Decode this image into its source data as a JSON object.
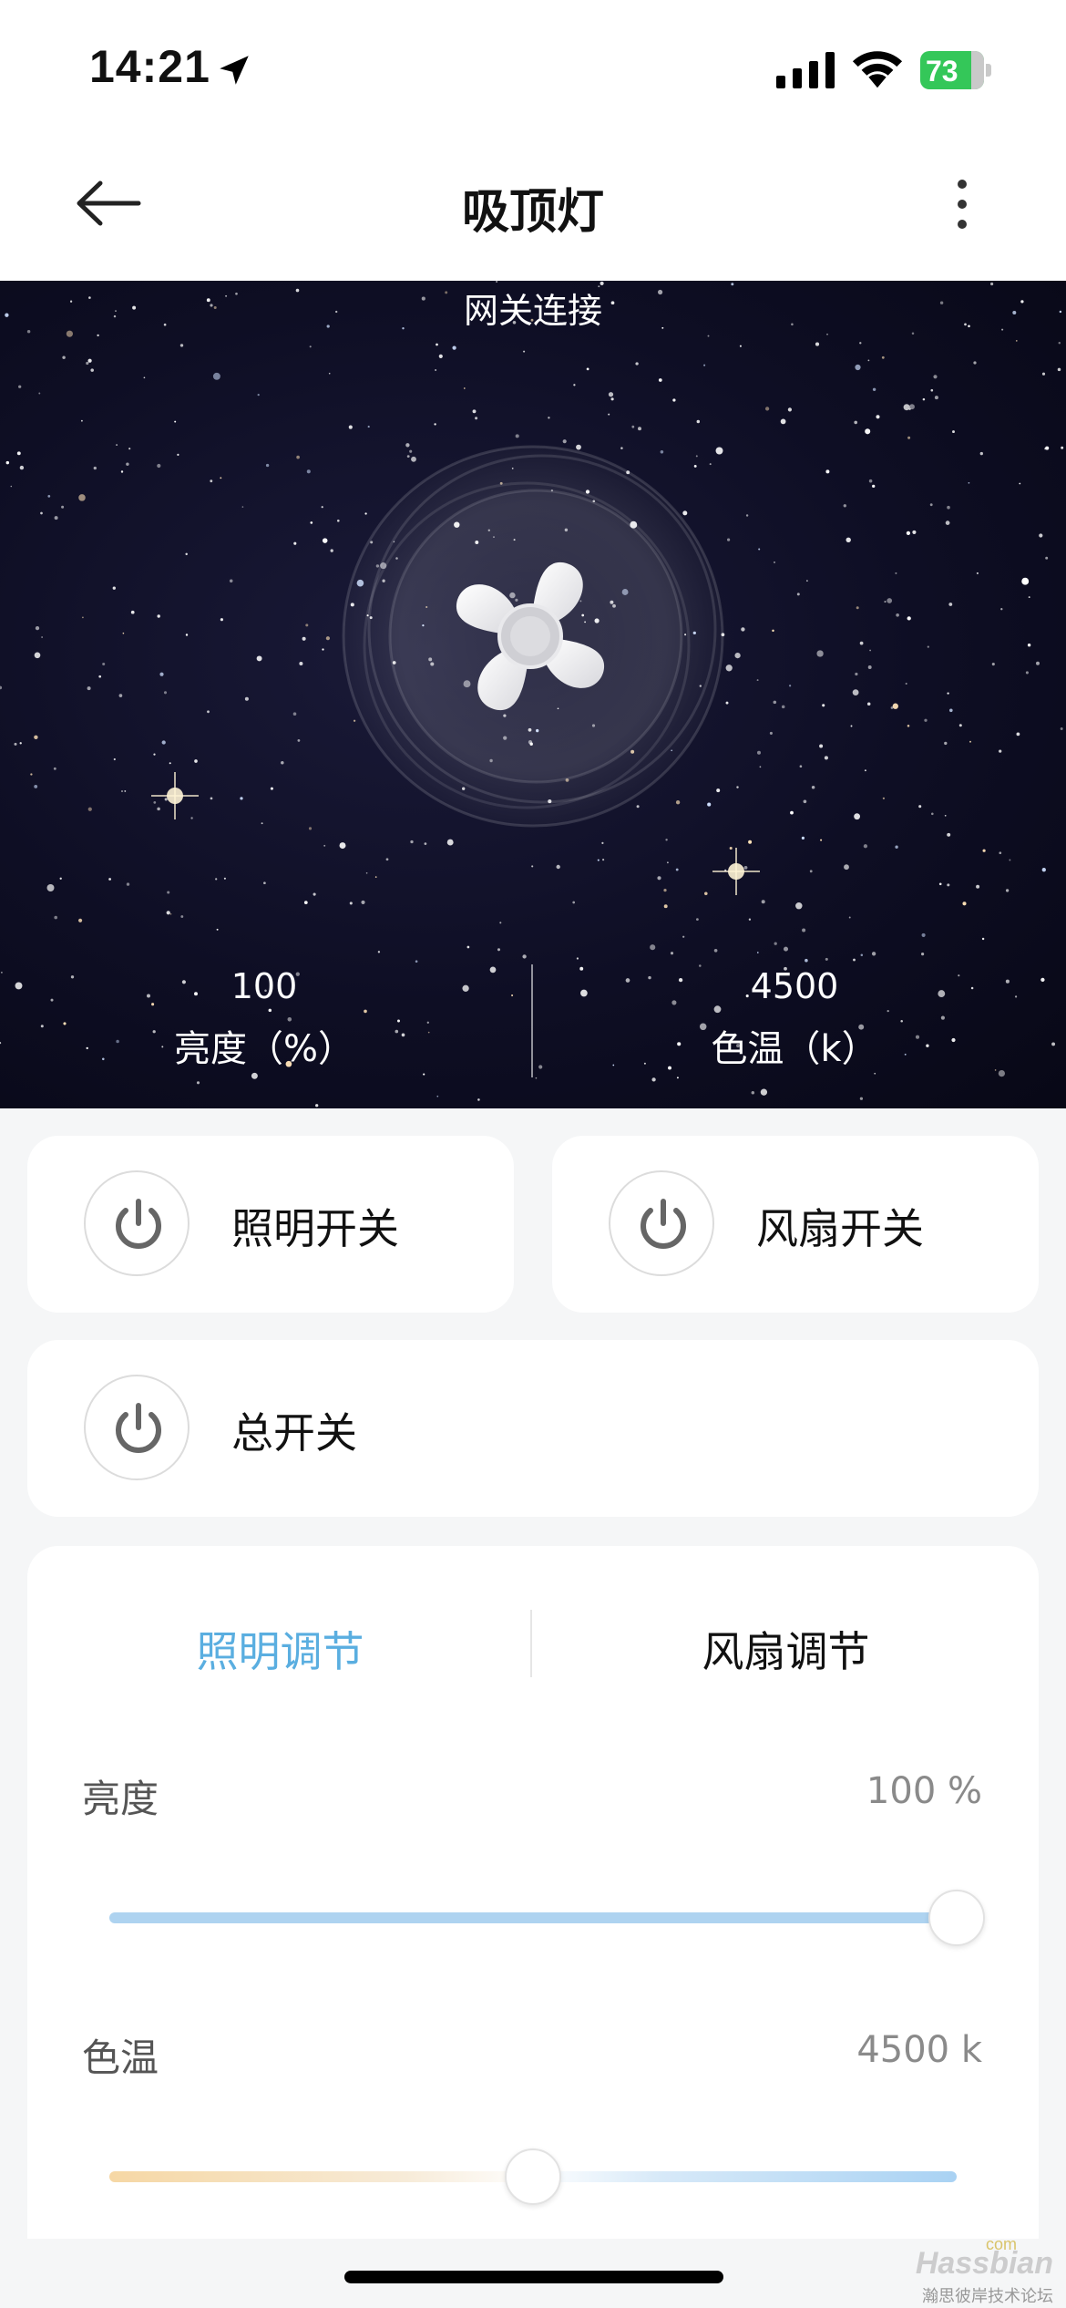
{
  "status_bar": {
    "time": "14:21",
    "battery": "73",
    "icons": [
      "location-arrow-icon",
      "cellular-signal-icon",
      "wifi-icon",
      "battery-charging-icon"
    ]
  },
  "header": {
    "title": "吸顶灯",
    "back_icon": "arrow-left-icon",
    "more_icon": "more-vertical-icon"
  },
  "hero": {
    "gateway_label": "网关连接",
    "brightness_value": "100",
    "brightness_label": "亮度（%）",
    "temperature_value": "4500",
    "temperature_label": "色温（k）"
  },
  "switches": {
    "light_label": "照明开关",
    "fan_label": "风扇开关",
    "master_label": "总开关",
    "icon": "power-icon"
  },
  "adjust": {
    "tabs": [
      {
        "label": "照明调节",
        "active": true
      },
      {
        "label": "风扇调节",
        "active": false
      }
    ],
    "brightness": {
      "label": "亮度",
      "value_text": "100 %",
      "level": 1.0
    },
    "color_temp": {
      "label": "色温",
      "value_text": "4500 k",
      "level": 0.5
    }
  },
  "colors": {
    "accent": "#5aaee0",
    "brightness_track": "#aed3f0",
    "battery": "#34c759"
  },
  "watermark": {
    "brand": "Hassbian",
    "domain_suffix": "com",
    "subtitle": "瀚思彼岸技术论坛"
  }
}
